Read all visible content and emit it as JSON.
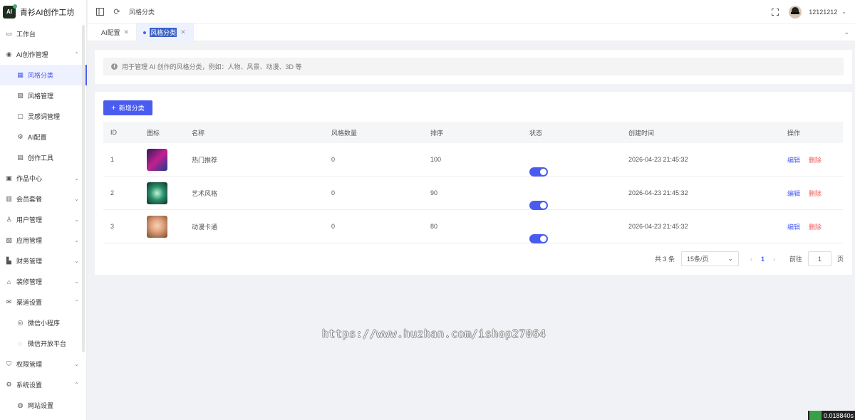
{
  "app": {
    "logo_text": "AI",
    "title": "青衫AI创作工坊"
  },
  "sidebar": {
    "items": [
      {
        "label": "工作台",
        "icon": "monitor-icon",
        "sub": false,
        "active": false,
        "chevron": ""
      },
      {
        "label": "AI创作管理",
        "icon": "ai-icon",
        "sub": false,
        "active": false,
        "chevron": "up"
      },
      {
        "label": "风格分类",
        "icon": "grid-icon",
        "sub": true,
        "active": true,
        "chevron": ""
      },
      {
        "label": "风格管理",
        "icon": "image-icon",
        "sub": true,
        "active": false,
        "chevron": ""
      },
      {
        "label": "灵感词管理",
        "icon": "chat-icon",
        "sub": true,
        "active": false,
        "chevron": ""
      },
      {
        "label": "AI配置",
        "icon": "gear-icon",
        "sub": true,
        "active": false,
        "chevron": ""
      },
      {
        "label": "创作工具",
        "icon": "tool-icon",
        "sub": true,
        "active": false,
        "chevron": ""
      },
      {
        "label": "作品中心",
        "icon": "picture-icon",
        "sub": false,
        "active": false,
        "chevron": "down"
      },
      {
        "label": "会员套餐",
        "icon": "gift-icon",
        "sub": false,
        "active": false,
        "chevron": "down"
      },
      {
        "label": "用户管理",
        "icon": "user-icon",
        "sub": false,
        "active": false,
        "chevron": "down"
      },
      {
        "label": "应用管理",
        "icon": "app-icon",
        "sub": false,
        "active": false,
        "chevron": "down"
      },
      {
        "label": "财务管理",
        "icon": "chart-icon",
        "sub": false,
        "active": false,
        "chevron": "down"
      },
      {
        "label": "装修管理",
        "icon": "decor-icon",
        "sub": false,
        "active": false,
        "chevron": "down"
      },
      {
        "label": "渠道设置",
        "icon": "mail-icon",
        "sub": false,
        "active": false,
        "chevron": "up"
      },
      {
        "label": "微信小程序",
        "icon": "miniprogram-icon",
        "sub": true,
        "active": false,
        "chevron": ""
      },
      {
        "label": "微信开放平台",
        "icon": "wechat-icon",
        "sub": true,
        "active": false,
        "chevron": ""
      },
      {
        "label": "权限管理",
        "icon": "shield-icon",
        "sub": false,
        "active": false,
        "chevron": "down"
      },
      {
        "label": "系统设置",
        "icon": "settings-icon",
        "sub": false,
        "active": false,
        "chevron": "up"
      },
      {
        "label": "网站设置",
        "icon": "globe-icon",
        "sub": true,
        "active": false,
        "chevron": ""
      }
    ]
  },
  "header": {
    "breadcrumb": "风格分类",
    "username": "12121212"
  },
  "tabs": [
    {
      "label": "AI配置",
      "active": false
    },
    {
      "label": "风格分类",
      "active": true
    }
  ],
  "notice": "用于管理 AI 创作的风格分类，例如：人物、风景、动漫、3D 等",
  "toolbar": {
    "add_label": "新增分类"
  },
  "table": {
    "columns": [
      "ID",
      "图标",
      "名称",
      "风格数量",
      "排序",
      "状态",
      "创建时间",
      "操作"
    ],
    "rows": [
      {
        "id": "1",
        "name": "热门推荐",
        "count": "0",
        "sort": "100",
        "status": true,
        "created": "2026-04-23 21:45:32",
        "thumb": "thumb-1"
      },
      {
        "id": "2",
        "name": "艺术风格",
        "count": "0",
        "sort": "90",
        "status": true,
        "created": "2026-04-23 21:45:32",
        "thumb": "thumb-2"
      },
      {
        "id": "3",
        "name": "动漫卡通",
        "count": "0",
        "sort": "80",
        "status": true,
        "created": "2026-04-23 21:45:32",
        "thumb": "thumb-3"
      }
    ],
    "edit_label": "编辑",
    "delete_label": "删除"
  },
  "pagination": {
    "total_text": "共 3 条",
    "page_size": "15条/页",
    "current_page": "1",
    "goto_label": "前往",
    "goto_value": "1",
    "page_unit": "页"
  },
  "watermark": "https://www.huzhan.com/ishop27064",
  "corner_text": "0.018840s",
  "colors": {
    "accent": "#4a5cf0",
    "danger": "#f05a5a"
  }
}
